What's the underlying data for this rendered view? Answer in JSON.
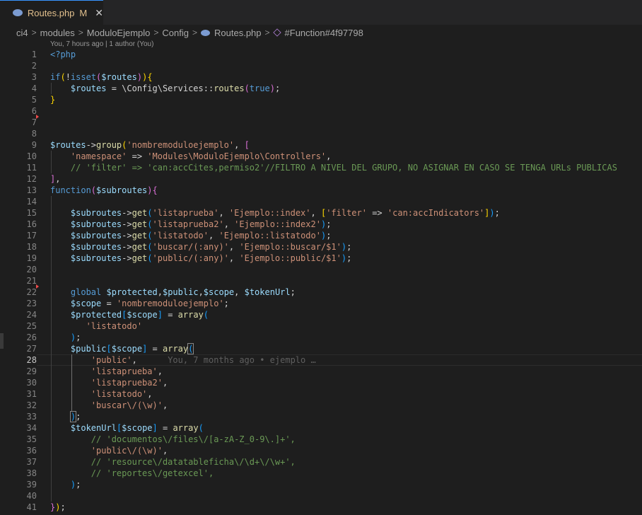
{
  "tab": {
    "icon": "php-elephant-icon",
    "filename": "Routes.php",
    "modified": "M",
    "close": "✕"
  },
  "breadcrumb": {
    "parts": [
      "ci4",
      "modules",
      "ModuloEjemplo",
      "Config",
      "Routes.php",
      "#Function#4f97798"
    ]
  },
  "blame_header": "You, 7 hours ago | 1 author (You)",
  "inline_blame": "You, 7 months ago • ejemplo …",
  "active_line": "28",
  "lines": [
    {
      "n": "1",
      "t": [
        [
          "k",
          "<?php"
        ]
      ]
    },
    {
      "n": "2",
      "t": []
    },
    {
      "n": "3",
      "t": [
        [
          "k",
          "if"
        ],
        [
          "b1",
          "("
        ],
        [
          "p",
          "!"
        ],
        [
          "k",
          "isset"
        ],
        [
          "b2",
          "("
        ],
        [
          "v",
          "$routes"
        ],
        [
          "b2",
          ")"
        ],
        [
          "b1",
          ")"
        ],
        [
          "b1",
          "{"
        ]
      ]
    },
    {
      "n": "4",
      "t": [
        [
          "p",
          "    "
        ],
        [
          "v",
          "$routes"
        ],
        [
          "p",
          " = \\Config\\Services::"
        ],
        [
          "f",
          "routes"
        ],
        [
          "b2",
          "("
        ],
        [
          "k",
          "true"
        ],
        [
          "b2",
          ")"
        ],
        [
          "p",
          ";"
        ]
      ]
    },
    {
      "n": "5",
      "t": [
        [
          "b1",
          "}"
        ]
      ]
    },
    {
      "n": "6",
      "t": []
    },
    {
      "n": "7",
      "t": []
    },
    {
      "n": "8",
      "t": []
    },
    {
      "n": "9",
      "t": [
        [
          "v",
          "$routes"
        ],
        [
          "p",
          "->"
        ],
        [
          "f",
          "group"
        ],
        [
          "b1",
          "("
        ],
        [
          "s",
          "'nombremoduloejemplo'"
        ],
        [
          "p",
          ", "
        ],
        [
          "b2",
          "["
        ]
      ]
    },
    {
      "n": "10",
      "t": [
        [
          "p",
          "    "
        ],
        [
          "s",
          "'namespace'"
        ],
        [
          "p",
          " => "
        ],
        [
          "s",
          "'Modules\\ModuloEjemplo\\Controllers'"
        ],
        [
          "p",
          ","
        ]
      ]
    },
    {
      "n": "11",
      "t": [
        [
          "p",
          "    "
        ],
        [
          "c",
          "// 'filter' => 'can:accCites,permiso2'//FILTRO A NIVEL DEL GRUPO, NO ASIGNAR EN CASO SE TENGA URLs PUBLICAS"
        ]
      ]
    },
    {
      "n": "12",
      "t": [
        [
          "b2",
          "]"
        ],
        [
          "p",
          ","
        ]
      ]
    },
    {
      "n": "13",
      "t": [
        [
          "k",
          "function"
        ],
        [
          "b2",
          "("
        ],
        [
          "v",
          "$subroutes"
        ],
        [
          "b2",
          ")"
        ],
        [
          "b2",
          "{"
        ]
      ]
    },
    {
      "n": "14",
      "t": []
    },
    {
      "n": "15",
      "t": [
        [
          "p",
          "    "
        ],
        [
          "v",
          "$subroutes"
        ],
        [
          "p",
          "->"
        ],
        [
          "f",
          "get"
        ],
        [
          "b3",
          "("
        ],
        [
          "s",
          "'listaprueba'"
        ],
        [
          "p",
          ", "
        ],
        [
          "s",
          "'Ejemplo::index'"
        ],
        [
          "p",
          ", "
        ],
        [
          "b1",
          "["
        ],
        [
          "s",
          "'filter'"
        ],
        [
          "p",
          " => "
        ],
        [
          "s",
          "'can:accIndicators'"
        ],
        [
          "b1",
          "]"
        ],
        [
          "b3",
          ")"
        ],
        [
          "p",
          ";"
        ]
      ]
    },
    {
      "n": "16",
      "t": [
        [
          "p",
          "    "
        ],
        [
          "v",
          "$subroutes"
        ],
        [
          "p",
          "->"
        ],
        [
          "f",
          "get"
        ],
        [
          "b3",
          "("
        ],
        [
          "s",
          "'listaprueba2'"
        ],
        [
          "p",
          ", "
        ],
        [
          "s",
          "'Ejemplo::index2'"
        ],
        [
          "b3",
          ")"
        ],
        [
          "p",
          ";"
        ]
      ]
    },
    {
      "n": "17",
      "t": [
        [
          "p",
          "    "
        ],
        [
          "v",
          "$subroutes"
        ],
        [
          "p",
          "->"
        ],
        [
          "f",
          "get"
        ],
        [
          "b3",
          "("
        ],
        [
          "s",
          "'listatodo'"
        ],
        [
          "p",
          ", "
        ],
        [
          "s",
          "'Ejemplo::listatodo'"
        ],
        [
          "b3",
          ")"
        ],
        [
          "p",
          ";"
        ]
      ]
    },
    {
      "n": "18",
      "t": [
        [
          "p",
          "    "
        ],
        [
          "v",
          "$subroutes"
        ],
        [
          "p",
          "->"
        ],
        [
          "f",
          "get"
        ],
        [
          "b3",
          "("
        ],
        [
          "s",
          "'buscar/(:any)'"
        ],
        [
          "p",
          ", "
        ],
        [
          "s",
          "'Ejemplo::buscar/$1'"
        ],
        [
          "b3",
          ")"
        ],
        [
          "p",
          ";"
        ]
      ]
    },
    {
      "n": "19",
      "t": [
        [
          "p",
          "    "
        ],
        [
          "v",
          "$subroutes"
        ],
        [
          "p",
          "->"
        ],
        [
          "f",
          "get"
        ],
        [
          "b3",
          "("
        ],
        [
          "s",
          "'public/(:any)'"
        ],
        [
          "p",
          ", "
        ],
        [
          "s",
          "'Ejemplo::public/$1'"
        ],
        [
          "b3",
          ")"
        ],
        [
          "p",
          ";"
        ]
      ]
    },
    {
      "n": "20",
      "t": []
    },
    {
      "n": "21",
      "t": []
    },
    {
      "n": "22",
      "t": [
        [
          "p",
          "    "
        ],
        [
          "k",
          "global"
        ],
        [
          "p",
          " "
        ],
        [
          "v",
          "$protected"
        ],
        [
          "p",
          ","
        ],
        [
          "v",
          "$public"
        ],
        [
          "p",
          ","
        ],
        [
          "v",
          "$scope"
        ],
        [
          "p",
          ", "
        ],
        [
          "v",
          "$tokenUrl"
        ],
        [
          "p",
          ";"
        ]
      ]
    },
    {
      "n": "23",
      "t": [
        [
          "p",
          "    "
        ],
        [
          "v",
          "$scope"
        ],
        [
          "p",
          " = "
        ],
        [
          "s",
          "'nombremoduloejemplo'"
        ],
        [
          "p",
          ";"
        ]
      ]
    },
    {
      "n": "24",
      "t": [
        [
          "p",
          "    "
        ],
        [
          "v",
          "$protected"
        ],
        [
          "b3",
          "["
        ],
        [
          "v",
          "$scope"
        ],
        [
          "b3",
          "]"
        ],
        [
          "p",
          " = "
        ],
        [
          "f",
          "array"
        ],
        [
          "b3",
          "("
        ]
      ]
    },
    {
      "n": "25",
      "t": [
        [
          "p",
          "       "
        ],
        [
          "s",
          "'listatodo'"
        ]
      ]
    },
    {
      "n": "26",
      "t": [
        [
          "p",
          "    "
        ],
        [
          "b3",
          ")"
        ],
        [
          "p",
          ";"
        ]
      ]
    },
    {
      "n": "27",
      "t": [
        [
          "p",
          "    "
        ],
        [
          "v",
          "$public"
        ],
        [
          "b3",
          "["
        ],
        [
          "v",
          "$scope"
        ],
        [
          "b3",
          "]"
        ],
        [
          "p",
          " = "
        ],
        [
          "f",
          "array"
        ],
        [
          "b3x",
          "("
        ]
      ]
    },
    {
      "n": "28",
      "t": [
        [
          "p",
          "        "
        ],
        [
          "s",
          "'public'"
        ],
        [
          "p",
          ","
        ],
        [
          "p",
          "      "
        ],
        [
          "g",
          "You, 7 months ago • ejemplo …"
        ]
      ]
    },
    {
      "n": "29",
      "t": [
        [
          "p",
          "        "
        ],
        [
          "s",
          "'listaprueba'"
        ],
        [
          "p",
          ","
        ]
      ]
    },
    {
      "n": "30",
      "t": [
        [
          "p",
          "        "
        ],
        [
          "s",
          "'listaprueba2'"
        ],
        [
          "p",
          ","
        ]
      ]
    },
    {
      "n": "31",
      "t": [
        [
          "p",
          "        "
        ],
        [
          "s",
          "'listatodo'"
        ],
        [
          "p",
          ","
        ]
      ]
    },
    {
      "n": "32",
      "t": [
        [
          "p",
          "        "
        ],
        [
          "s",
          "'buscar\\/(\\w)'"
        ],
        [
          "p",
          ","
        ]
      ]
    },
    {
      "n": "33",
      "t": [
        [
          "p",
          "    "
        ],
        [
          "b3x",
          ")"
        ],
        [
          "p",
          ";"
        ]
      ]
    },
    {
      "n": "34",
      "t": [
        [
          "p",
          "    "
        ],
        [
          "v",
          "$tokenUrl"
        ],
        [
          "b3",
          "["
        ],
        [
          "v",
          "$scope"
        ],
        [
          "b3",
          "]"
        ],
        [
          "p",
          " = "
        ],
        [
          "f",
          "array"
        ],
        [
          "b3",
          "("
        ]
      ]
    },
    {
      "n": "35",
      "t": [
        [
          "p",
          "        "
        ],
        [
          "c",
          "// 'documentos\\/files\\/[a-zA-Z_0-9\\.]+',"
        ]
      ]
    },
    {
      "n": "36",
      "t": [
        [
          "p",
          "        "
        ],
        [
          "s",
          "'public\\/(\\w)'"
        ],
        [
          "p",
          ","
        ]
      ]
    },
    {
      "n": "37",
      "t": [
        [
          "p",
          "        "
        ],
        [
          "c",
          "// 'resource\\/datatableficha\\/\\d+\\/\\w+',"
        ]
      ]
    },
    {
      "n": "38",
      "t": [
        [
          "p",
          "        "
        ],
        [
          "c",
          "// 'reportes\\/getexcel',"
        ]
      ]
    },
    {
      "n": "39",
      "t": [
        [
          "p",
          "    "
        ],
        [
          "b3",
          ")"
        ],
        [
          "p",
          ";"
        ]
      ]
    },
    {
      "n": "40",
      "t": []
    },
    {
      "n": "41",
      "t": [
        [
          "b2",
          "}"
        ],
        [
          "b1",
          ")"
        ],
        [
          "p",
          ";"
        ]
      ]
    }
  ]
}
